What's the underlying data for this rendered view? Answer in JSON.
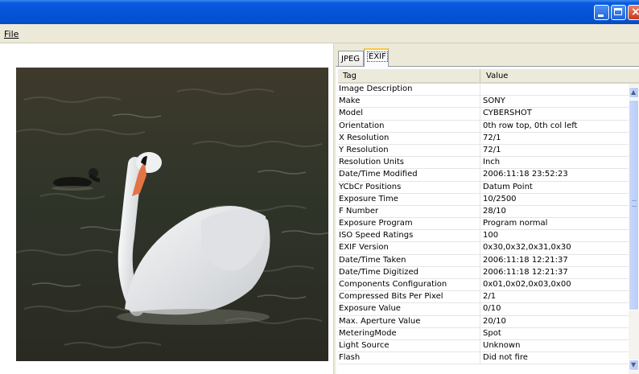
{
  "menu": {
    "file_label": "File"
  },
  "window": {
    "close_glyph": "×"
  },
  "tabs": [
    {
      "label": "JPEG",
      "selected": false
    },
    {
      "label": "EXIF",
      "selected": true
    }
  ],
  "list": {
    "headers": {
      "tag": "Tag",
      "value": "Value"
    },
    "rows": [
      {
        "tag": "Image Description",
        "value": ""
      },
      {
        "tag": "Make",
        "value": "SONY"
      },
      {
        "tag": "Model",
        "value": "CYBERSHOT"
      },
      {
        "tag": "Orientation",
        "value": "0th row top, 0th col left"
      },
      {
        "tag": "X Resolution",
        "value": "72/1"
      },
      {
        "tag": "Y Resolution",
        "value": "72/1"
      },
      {
        "tag": "Resolution Units",
        "value": "Inch"
      },
      {
        "tag": "Date/Time Modified",
        "value": "2006:11:18 23:52:23"
      },
      {
        "tag": "YCbCr Positions",
        "value": "Datum Point"
      },
      {
        "tag": "Exposure Time",
        "value": "10/2500"
      },
      {
        "tag": "F Number",
        "value": "28/10"
      },
      {
        "tag": "Exposure Program",
        "value": "Program normal"
      },
      {
        "tag": "ISO Speed Ratings",
        "value": "100"
      },
      {
        "tag": "EXIF Version",
        "value": "0x30,0x32,0x31,0x30"
      },
      {
        "tag": "Date/Time Taken",
        "value": "2006:11:18 12:21:37"
      },
      {
        "tag": "Date/Time Digitized",
        "value": "2006:11:18 12:21:37"
      },
      {
        "tag": "Components Configuration",
        "value": "0x01,0x02,0x03,0x00"
      },
      {
        "tag": "Compressed Bits Per Pixel",
        "value": "2/1"
      },
      {
        "tag": "Exposure Value",
        "value": "0/10"
      },
      {
        "tag": "Max. Aperture Value",
        "value": "20/10"
      },
      {
        "tag": "MeteringMode",
        "value": "Spot"
      },
      {
        "tag": "Light Source",
        "value": "Unknown"
      },
      {
        "tag": "Flash",
        "value": "Did not fire"
      }
    ]
  },
  "colors": {
    "titlebar": "#0453d8",
    "selected_tab_accent": "#ffc83c",
    "scrollbar": "#b9cdf8"
  }
}
